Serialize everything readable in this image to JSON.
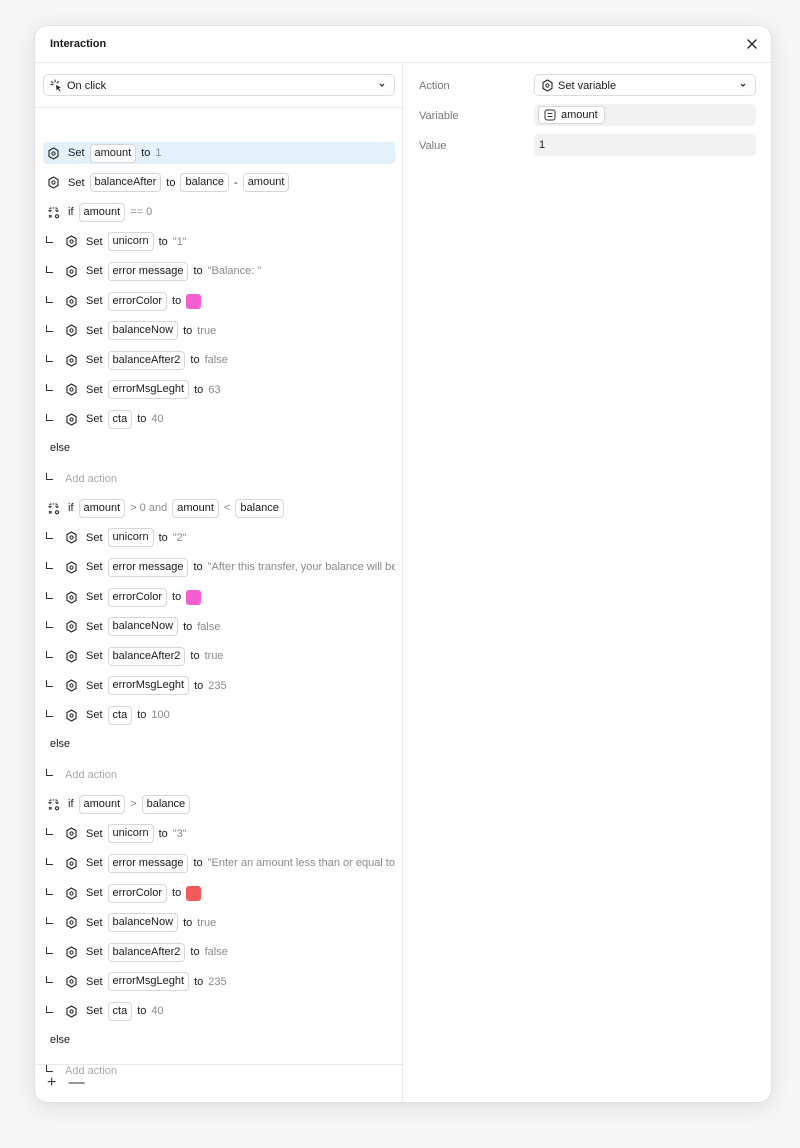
{
  "dialog": {
    "title": "Interaction"
  },
  "trigger": {
    "label": "On click"
  },
  "rows": [
    {
      "type": "set",
      "indent": false,
      "selected": true,
      "parts": [
        {
          "k": "kw",
          "t": "Set"
        },
        {
          "k": "pill",
          "t": "amount"
        },
        {
          "k": "kw",
          "t": "to"
        },
        {
          "k": "lit",
          "t": "1"
        }
      ]
    },
    {
      "type": "set",
      "indent": false,
      "parts": [
        {
          "k": "kw",
          "t": "Set"
        },
        {
          "k": "pill",
          "t": "balanceAfter"
        },
        {
          "k": "kw",
          "t": "to"
        },
        {
          "k": "pill",
          "t": "balance"
        },
        {
          "k": "kw",
          "t": "-"
        },
        {
          "k": "pill",
          "t": "amount"
        }
      ]
    },
    {
      "type": "if",
      "parts": [
        {
          "k": "kw",
          "t": "if"
        },
        {
          "k": "pill",
          "t": "amount"
        },
        {
          "k": "lit",
          "t": "== 0"
        }
      ]
    },
    {
      "type": "set",
      "indent": true,
      "parts": [
        {
          "k": "kw",
          "t": "Set"
        },
        {
          "k": "pill",
          "t": "unicorn"
        },
        {
          "k": "kw",
          "t": "to"
        },
        {
          "k": "lit",
          "t": "\"1\""
        }
      ]
    },
    {
      "type": "set",
      "indent": true,
      "parts": [
        {
          "k": "kw",
          "t": "Set"
        },
        {
          "k": "pill",
          "t": "error message"
        },
        {
          "k": "kw",
          "t": "to"
        },
        {
          "k": "lit",
          "t": "\"Balance: \""
        }
      ]
    },
    {
      "type": "set",
      "indent": true,
      "parts": [
        {
          "k": "kw",
          "t": "Set"
        },
        {
          "k": "pill",
          "t": "errorColor"
        },
        {
          "k": "kw",
          "t": "to"
        },
        {
          "k": "swatch",
          "c": "#f55ecf"
        }
      ]
    },
    {
      "type": "set",
      "indent": true,
      "parts": [
        {
          "k": "kw",
          "t": "Set"
        },
        {
          "k": "pill",
          "t": "balanceNow"
        },
        {
          "k": "kw",
          "t": "to"
        },
        {
          "k": "lit",
          "t": "true"
        }
      ]
    },
    {
      "type": "set",
      "indent": true,
      "parts": [
        {
          "k": "kw",
          "t": "Set"
        },
        {
          "k": "pill",
          "t": "balanceAfter2"
        },
        {
          "k": "kw",
          "t": "to"
        },
        {
          "k": "lit",
          "t": "false"
        }
      ]
    },
    {
      "type": "set",
      "indent": true,
      "parts": [
        {
          "k": "kw",
          "t": "Set"
        },
        {
          "k": "pill",
          "t": "errorMsgLeght"
        },
        {
          "k": "kw",
          "t": "to"
        },
        {
          "k": "lit",
          "t": "63"
        }
      ]
    },
    {
      "type": "set",
      "indent": true,
      "parts": [
        {
          "k": "kw",
          "t": "Set"
        },
        {
          "k": "pill",
          "t": "cta"
        },
        {
          "k": "kw",
          "t": "to"
        },
        {
          "k": "lit",
          "t": "40"
        }
      ]
    },
    {
      "type": "else",
      "label": "else"
    },
    {
      "type": "add",
      "label": "Add action"
    },
    {
      "type": "if",
      "parts": [
        {
          "k": "kw",
          "t": "if"
        },
        {
          "k": "pill",
          "t": "amount"
        },
        {
          "k": "lit",
          "t": "> 0 and"
        },
        {
          "k": "pill",
          "t": "amount"
        },
        {
          "k": "lit",
          "t": "<"
        },
        {
          "k": "pill",
          "t": "balance"
        }
      ]
    },
    {
      "type": "set",
      "indent": true,
      "parts": [
        {
          "k": "kw",
          "t": "Set"
        },
        {
          "k": "pill",
          "t": "unicorn"
        },
        {
          "k": "kw",
          "t": "to"
        },
        {
          "k": "lit",
          "t": "\"2\""
        }
      ]
    },
    {
      "type": "set",
      "indent": true,
      "parts": [
        {
          "k": "kw",
          "t": "Set"
        },
        {
          "k": "pill",
          "t": "error message"
        },
        {
          "k": "kw",
          "t": "to"
        },
        {
          "k": "lit",
          "t": "\"After this transfer, your balance will be"
        }
      ]
    },
    {
      "type": "set",
      "indent": true,
      "parts": [
        {
          "k": "kw",
          "t": "Set"
        },
        {
          "k": "pill",
          "t": "errorColor"
        },
        {
          "k": "kw",
          "t": "to"
        },
        {
          "k": "swatch",
          "c": "#f55ecf"
        }
      ]
    },
    {
      "type": "set",
      "indent": true,
      "parts": [
        {
          "k": "kw",
          "t": "Set"
        },
        {
          "k": "pill",
          "t": "balanceNow"
        },
        {
          "k": "kw",
          "t": "to"
        },
        {
          "k": "lit",
          "t": "false"
        }
      ]
    },
    {
      "type": "set",
      "indent": true,
      "parts": [
        {
          "k": "kw",
          "t": "Set"
        },
        {
          "k": "pill",
          "t": "balanceAfter2"
        },
        {
          "k": "kw",
          "t": "to"
        },
        {
          "k": "lit",
          "t": "true"
        }
      ]
    },
    {
      "type": "set",
      "indent": true,
      "parts": [
        {
          "k": "kw",
          "t": "Set"
        },
        {
          "k": "pill",
          "t": "errorMsgLeght"
        },
        {
          "k": "kw",
          "t": "to"
        },
        {
          "k": "lit",
          "t": "235"
        }
      ]
    },
    {
      "type": "set",
      "indent": true,
      "parts": [
        {
          "k": "kw",
          "t": "Set"
        },
        {
          "k": "pill",
          "t": "cta"
        },
        {
          "k": "kw",
          "t": "to"
        },
        {
          "k": "lit",
          "t": "100"
        }
      ]
    },
    {
      "type": "else",
      "label": "else"
    },
    {
      "type": "add",
      "label": "Add action"
    },
    {
      "type": "if",
      "parts": [
        {
          "k": "kw",
          "t": "if"
        },
        {
          "k": "pill",
          "t": "amount"
        },
        {
          "k": "lit",
          "t": ">"
        },
        {
          "k": "pill",
          "t": "balance"
        }
      ]
    },
    {
      "type": "set",
      "indent": true,
      "parts": [
        {
          "k": "kw",
          "t": "Set"
        },
        {
          "k": "pill",
          "t": "unicorn"
        },
        {
          "k": "kw",
          "t": "to"
        },
        {
          "k": "lit",
          "t": "\"3\""
        }
      ]
    },
    {
      "type": "set",
      "indent": true,
      "parts": [
        {
          "k": "kw",
          "t": "Set"
        },
        {
          "k": "pill",
          "t": "error message"
        },
        {
          "k": "kw",
          "t": "to"
        },
        {
          "k": "lit",
          "t": "\"Enter an amount less than or equal to"
        }
      ]
    },
    {
      "type": "set",
      "indent": true,
      "parts": [
        {
          "k": "kw",
          "t": "Set"
        },
        {
          "k": "pill",
          "t": "errorColor"
        },
        {
          "k": "kw",
          "t": "to"
        },
        {
          "k": "swatch",
          "c": "#f25a5a"
        }
      ]
    },
    {
      "type": "set",
      "indent": true,
      "parts": [
        {
          "k": "kw",
          "t": "Set"
        },
        {
          "k": "pill",
          "t": "balanceNow"
        },
        {
          "k": "kw",
          "t": "to"
        },
        {
          "k": "lit",
          "t": "true"
        }
      ]
    },
    {
      "type": "set",
      "indent": true,
      "parts": [
        {
          "k": "kw",
          "t": "Set"
        },
        {
          "k": "pill",
          "t": "balanceAfter2"
        },
        {
          "k": "kw",
          "t": "to"
        },
        {
          "k": "lit",
          "t": "false"
        }
      ]
    },
    {
      "type": "set",
      "indent": true,
      "parts": [
        {
          "k": "kw",
          "t": "Set"
        },
        {
          "k": "pill",
          "t": "errorMsgLeght"
        },
        {
          "k": "kw",
          "t": "to"
        },
        {
          "k": "lit",
          "t": "235"
        }
      ]
    },
    {
      "type": "set",
      "indent": true,
      "parts": [
        {
          "k": "kw",
          "t": "Set"
        },
        {
          "k": "pill",
          "t": "cta"
        },
        {
          "k": "kw",
          "t": "to"
        },
        {
          "k": "lit",
          "t": "40"
        }
      ]
    },
    {
      "type": "else",
      "label": "else"
    },
    {
      "type": "add",
      "label": "Add action"
    }
  ],
  "footer": {
    "add": "+",
    "remove": "—"
  },
  "properties": {
    "action_label": "Action",
    "action_value": "Set variable",
    "variable_label": "Variable",
    "variable_value": "amount",
    "value_label": "Value",
    "value_value": "1"
  }
}
